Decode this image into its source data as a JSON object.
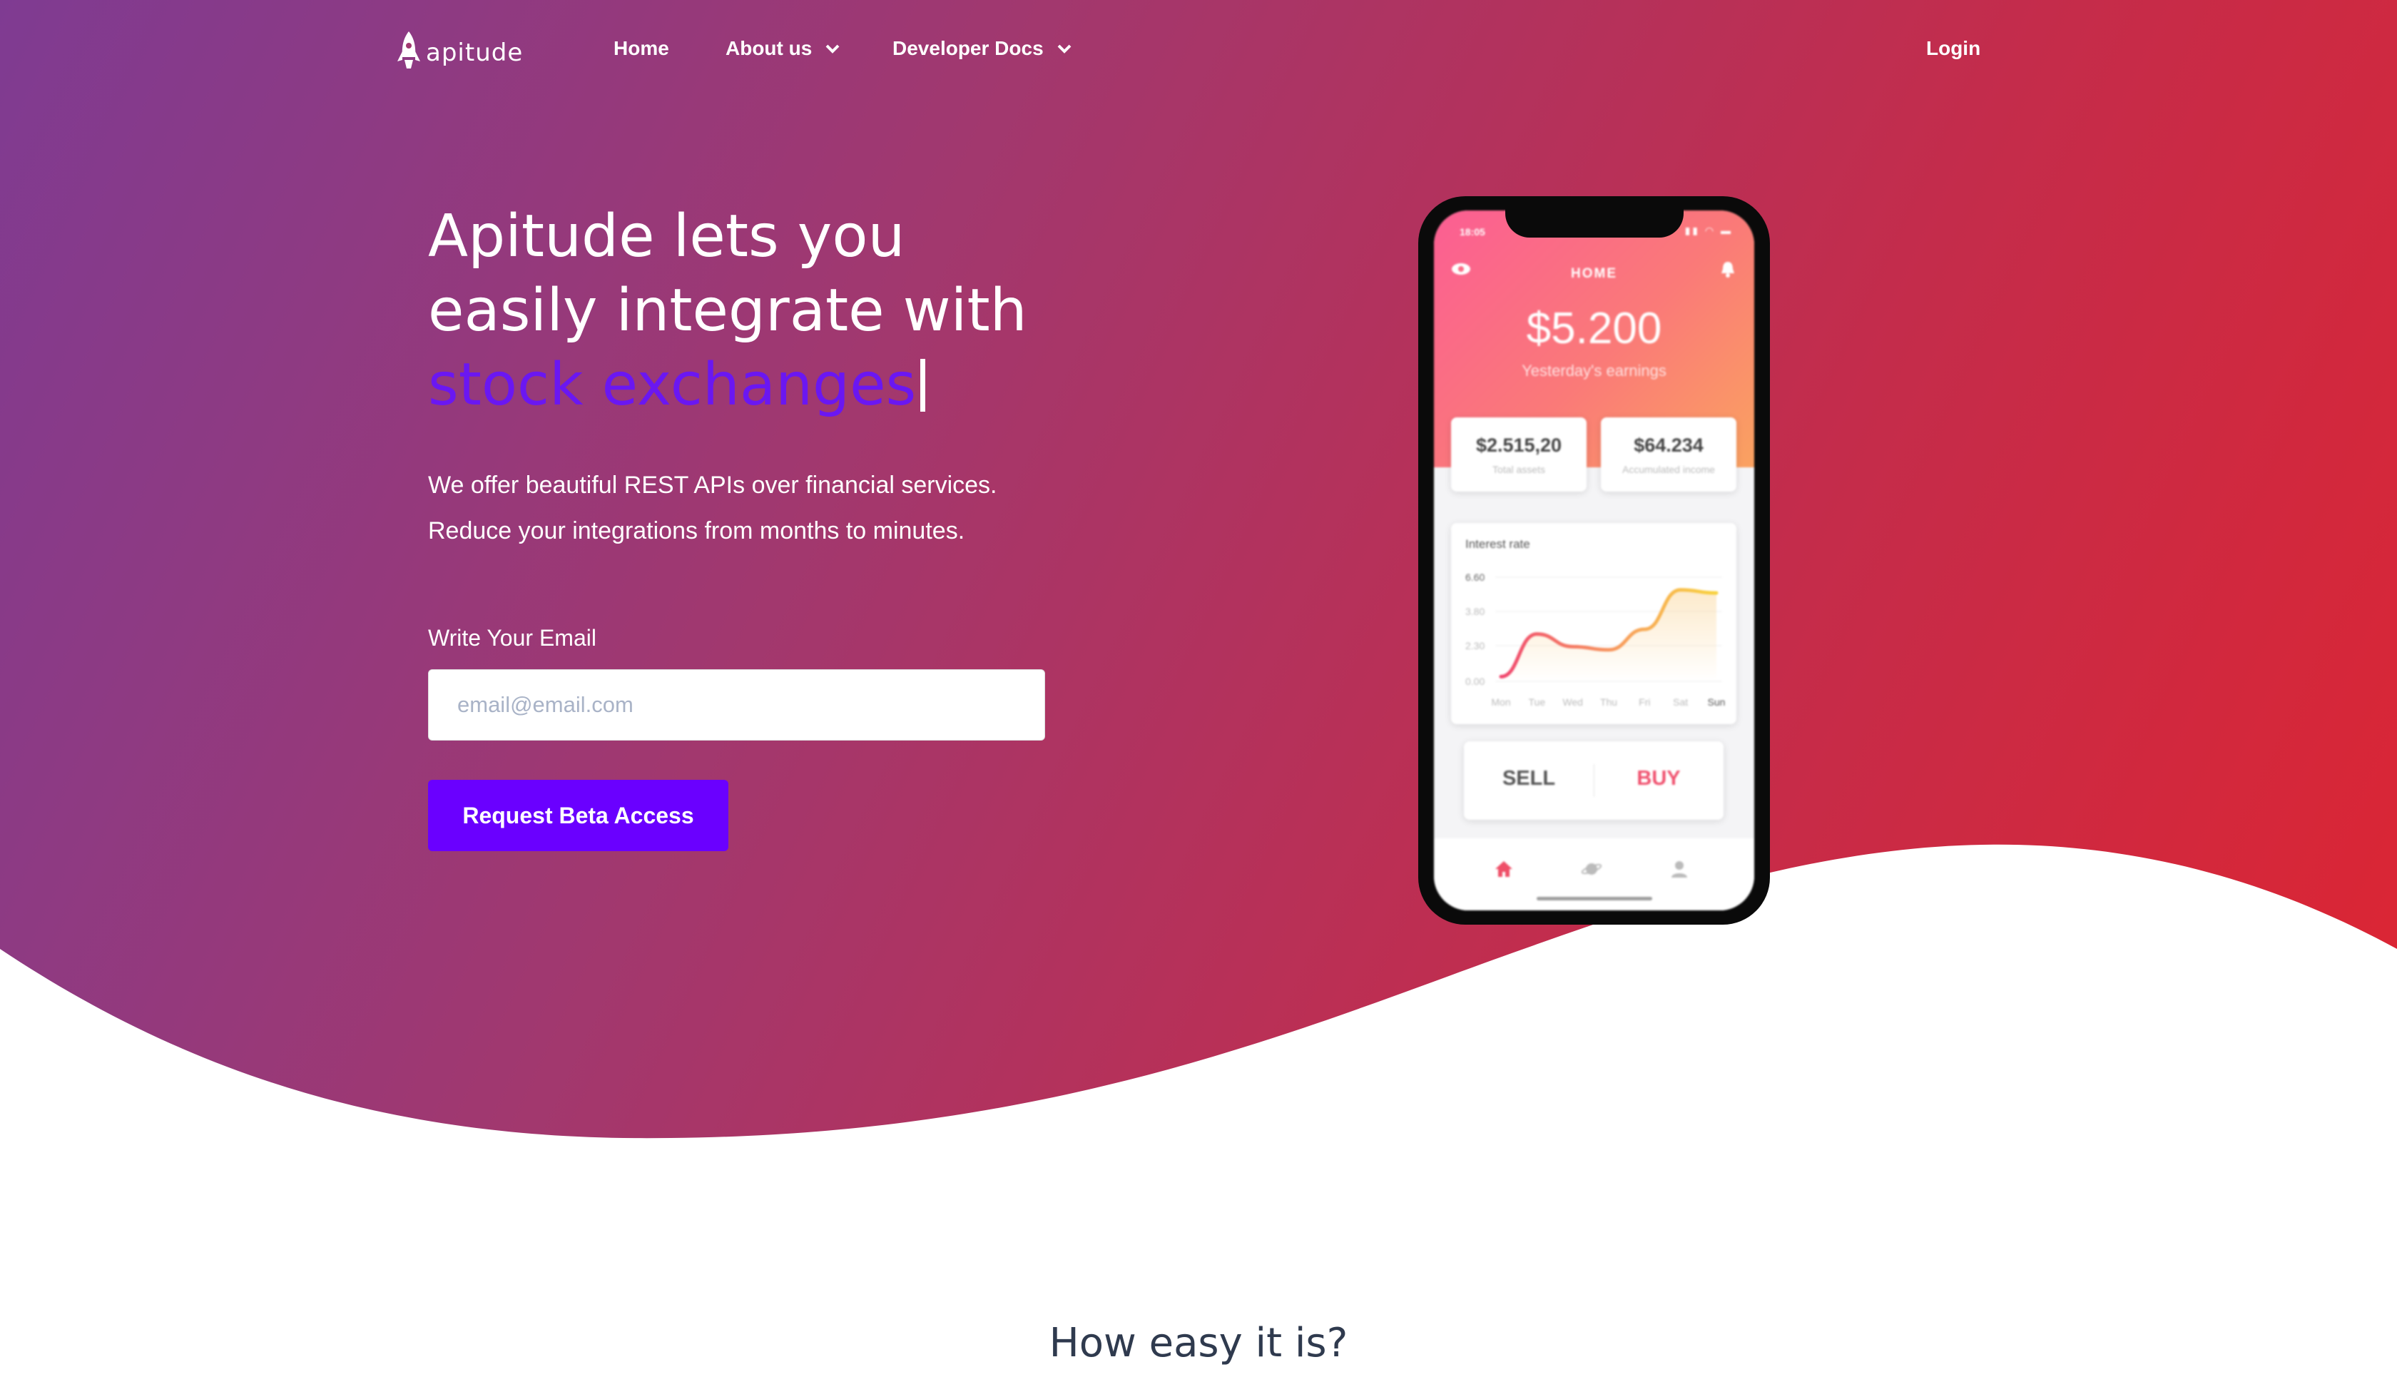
{
  "nav": {
    "logo_text": "apitude",
    "items": [
      {
        "label": "Home"
      },
      {
        "label": "About us"
      },
      {
        "label": "Developer Docs"
      }
    ],
    "login": "Login"
  },
  "hero": {
    "headline_part1": "Apitude lets you easily integrate with ",
    "headline_accent": "stock exchanges",
    "subtext_line1": "We offer beautiful REST APIs over financial services.",
    "subtext_line2": "Reduce your integrations from months to minutes.",
    "email_label": "Write Your Email",
    "email_placeholder": "email@email.com",
    "email_value": "",
    "cta": "Request Beta Access"
  },
  "phone": {
    "time": "18:05",
    "status_icons": "▮▮ ◠ ▬",
    "title": "HOME",
    "balance": "$5.200",
    "balance_caption": "Yesterday's earnings",
    "total_assets": "$2.515,20",
    "total_assets_label": "Total assets",
    "accumulated": "$64.234",
    "accumulated_label": "Accumulated income",
    "chart_title": "Interest rate",
    "sell": "SELL",
    "buy": "BUY",
    "tabs": [
      "home-icon",
      "planet-icon",
      "user-icon"
    ]
  },
  "chart_data": {
    "type": "line",
    "title": "Interest rate",
    "categories": [
      "Mon",
      "Tue",
      "Wed",
      "Thu",
      "Fri",
      "Sat",
      "Sun"
    ],
    "y_ticks": [
      "6.60",
      "3.80",
      "2.30",
      "0.00"
    ],
    "values": [
      0.3,
      3.0,
      2.2,
      2.0,
      3.3,
      5.8,
      5.6
    ],
    "ylim": [
      0,
      6.6
    ]
  },
  "section": {
    "title": "How easy it is?"
  },
  "colors": {
    "accent": "#6a00ff",
    "gradient_start": "#7f3b92",
    "gradient_end": "#dd2532"
  }
}
